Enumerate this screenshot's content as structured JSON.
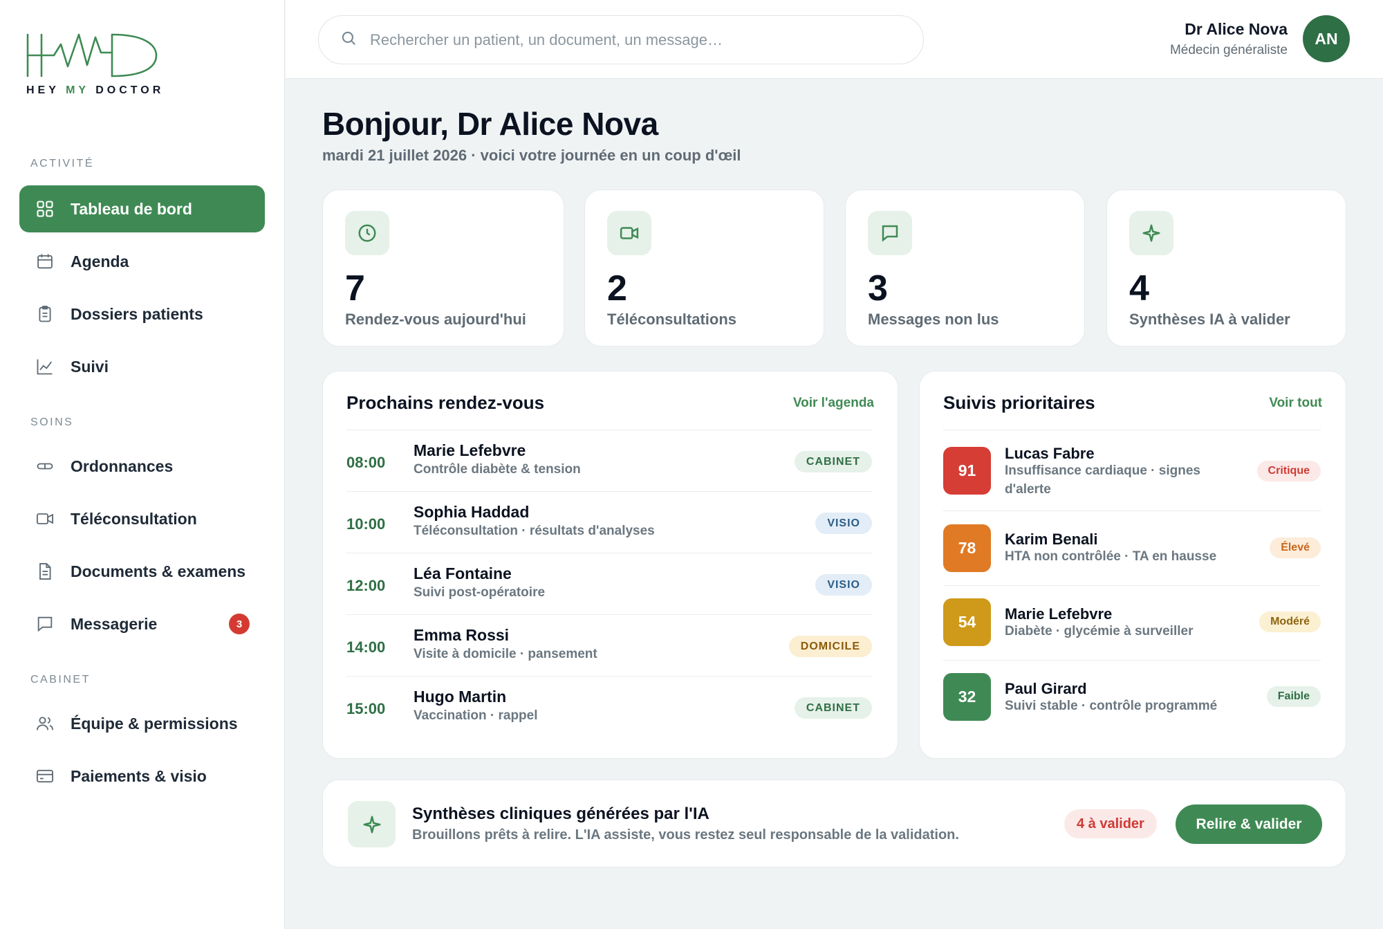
{
  "brand": {
    "name_part1": "HEY ",
    "name_part2": "MY",
    "name_part3": " DOCTOR",
    "accent": "#3f8a54"
  },
  "sidebar": {
    "sections": [
      {
        "label": "ACTIVITÉ"
      },
      {
        "label": "SOINS"
      },
      {
        "label": "CABINET"
      }
    ],
    "items": [
      {
        "label": "Tableau de bord",
        "icon": "grid-icon",
        "active": true
      },
      {
        "label": "Agenda",
        "icon": "calendar-icon"
      },
      {
        "label": "Dossiers patients",
        "icon": "clipboard-icon"
      },
      {
        "label": "Suivi",
        "icon": "chart-icon"
      },
      {
        "label": "Ordonnances",
        "icon": "pill-icon"
      },
      {
        "label": "Téléconsultation",
        "icon": "video-icon"
      },
      {
        "label": "Documents & examens",
        "icon": "document-icon"
      },
      {
        "label": "Messagerie",
        "icon": "message-icon",
        "badge": "3"
      },
      {
        "label": "Équipe & permissions",
        "icon": "users-icon"
      },
      {
        "label": "Paiements & visio",
        "icon": "credit-card-icon"
      }
    ]
  },
  "search": {
    "placeholder": "Rechercher un patient, un document, un message…",
    "value": ""
  },
  "user": {
    "name": "Dr Alice Nova",
    "role": "Médecin généraliste",
    "initials": "AN"
  },
  "greeting": {
    "title": "Bonjour, Dr Alice Nova",
    "subtitle": "mardi 21 juillet 2026 · voici votre journée en un coup d'œil"
  },
  "stats": [
    {
      "value": "7",
      "label": "Rendez-vous aujourd'hui",
      "icon": "clock-icon"
    },
    {
      "value": "2",
      "label": "Téléconsultations",
      "icon": "video-icon"
    },
    {
      "value": "3",
      "label": "Messages non lus",
      "icon": "message-icon"
    },
    {
      "value": "4",
      "label": "Synthèses IA à valider",
      "icon": "sparkle-icon"
    }
  ],
  "appointments": {
    "title": "Prochains rendez-vous",
    "link": "Voir l'agenda",
    "rows": [
      {
        "time": "08:00",
        "name": "Marie Lefebvre",
        "desc": "Contrôle diabète & tension",
        "type": "CABINET"
      },
      {
        "time": "10:00",
        "name": "Sophia Haddad",
        "desc": "Téléconsultation · résultats d'analyses",
        "type": "VISIO"
      },
      {
        "time": "12:00",
        "name": "Léa Fontaine",
        "desc": "Suivi post-opératoire",
        "type": "VISIO"
      },
      {
        "time": "14:00",
        "name": "Emma Rossi",
        "desc": "Visite à domicile · pansement",
        "type": "DOMICILE"
      },
      {
        "time": "15:00",
        "name": "Hugo Martin",
        "desc": "Vaccination · rappel",
        "type": "CABINET"
      }
    ]
  },
  "priorities": {
    "title": "Suivis prioritaires",
    "link": "Voir tout",
    "rows": [
      {
        "score": "91",
        "name": "Lucas Fabre",
        "desc": "Insuffisance cardiaque · signes d'alerte",
        "level": "Critique",
        "color": "#d63d35"
      },
      {
        "score": "78",
        "name": "Karim Benali",
        "desc": "HTA non contrôlée · TA en hausse",
        "level": "Élevé",
        "color": "#e07a24"
      },
      {
        "score": "54",
        "name": "Marie Lefebvre",
        "desc": "Diabète · glycémie à surveiller",
        "level": "Modéré",
        "color": "#cf9a1a"
      },
      {
        "score": "32",
        "name": "Paul Girard",
        "desc": "Suivi stable · contrôle programmé",
        "level": "Faible",
        "color": "#3f8a54"
      }
    ]
  },
  "ai_banner": {
    "title": "Synthèses cliniques générées par l'IA",
    "desc": "Brouillons prêts à relire. L'IA assiste, vous restez seul responsable de la validation.",
    "count": "4 à valider",
    "button": "Relire & valider"
  }
}
